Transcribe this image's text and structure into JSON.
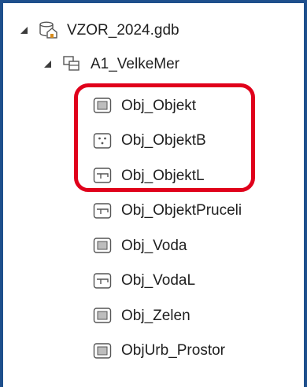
{
  "tree": {
    "gdb": {
      "label": "VZOR_2024.gdb",
      "icon": "geodatabase-icon",
      "expanded": true
    },
    "dataset": {
      "label": "A1_VelkeMer",
      "icon": "feature-dataset-icon",
      "expanded": true
    },
    "items": [
      {
        "label": "Obj_Objekt",
        "icon": "polygon-feature-class-icon"
      },
      {
        "label": "Obj_ObjektB",
        "icon": "point-feature-class-icon"
      },
      {
        "label": "Obj_ObjektL",
        "icon": "line-feature-class-icon"
      },
      {
        "label": "Obj_ObjektPruceli",
        "icon": "line-feature-class-icon"
      },
      {
        "label": "Obj_Voda",
        "icon": "polygon-feature-class-icon"
      },
      {
        "label": "Obj_VodaL",
        "icon": "line-feature-class-icon"
      },
      {
        "label": "Obj_Zelen",
        "icon": "polygon-feature-class-icon"
      },
      {
        "label": "ObjUrb_Prostor",
        "icon": "polygon-feature-class-icon"
      }
    ]
  },
  "highlight_color": "#e0001b",
  "frame_color": "#1e4f8c"
}
